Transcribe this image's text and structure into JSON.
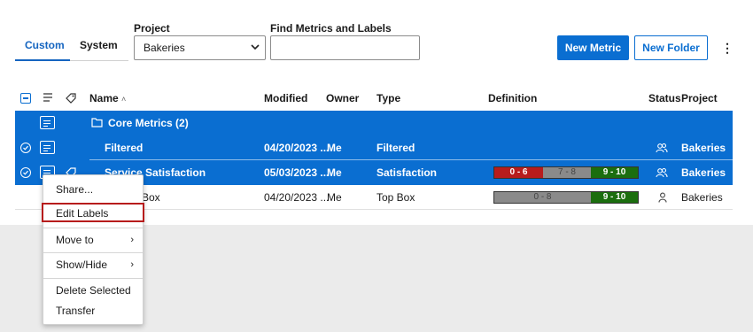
{
  "tabs": [
    {
      "label": "Custom"
    },
    {
      "label": "System"
    }
  ],
  "project": {
    "label": "Project",
    "selected": "Bakeries"
  },
  "search": {
    "label": "Find Metrics and Labels",
    "placeholder": ""
  },
  "buttons": {
    "new_metric": "New Metric",
    "new_folder": "New Folder",
    "more": "⋮"
  },
  "table": {
    "headers": {
      "name": "Name",
      "sort": "˄",
      "modified": "Modified",
      "owner": "Owner",
      "type": "Type",
      "definition": "Definition",
      "status": "Status",
      "project": "Project"
    },
    "folder": {
      "name": "Core Metrics (2)"
    },
    "rows": [
      {
        "name": "Filtered",
        "modified": "04/20/2023 ...",
        "owner": "Me",
        "type": "Filtered",
        "project": "Bakeries",
        "definition": []
      },
      {
        "name": "Service Satisfaction",
        "modified": "05/03/2023 ...",
        "owner": "Me",
        "type": "Satisfaction",
        "project": "Bakeries",
        "definition": [
          "0 - 6",
          "7 - 8",
          "9 - 10"
        ]
      },
      {
        "name": "Box",
        "modified": "04/20/2023 ...",
        "owner": "Me",
        "type": "Top Box",
        "project": "Bakeries",
        "definition": [
          "0 - 8",
          "9 - 10"
        ]
      }
    ]
  },
  "menu": {
    "items": [
      {
        "label": "Share..."
      },
      {
        "label": "Edit Labels"
      },
      {
        "label": "Move to",
        "arrow": "›"
      },
      {
        "label": "Show/Hide",
        "arrow": "›"
      },
      {
        "label": "Delete Selected"
      },
      {
        "label": "Transfer"
      }
    ]
  },
  "colors": {
    "accent": "#0a6ed1",
    "red": "#b71c1c",
    "green": "#1b6e0e",
    "grey": "#8a8a8a"
  }
}
